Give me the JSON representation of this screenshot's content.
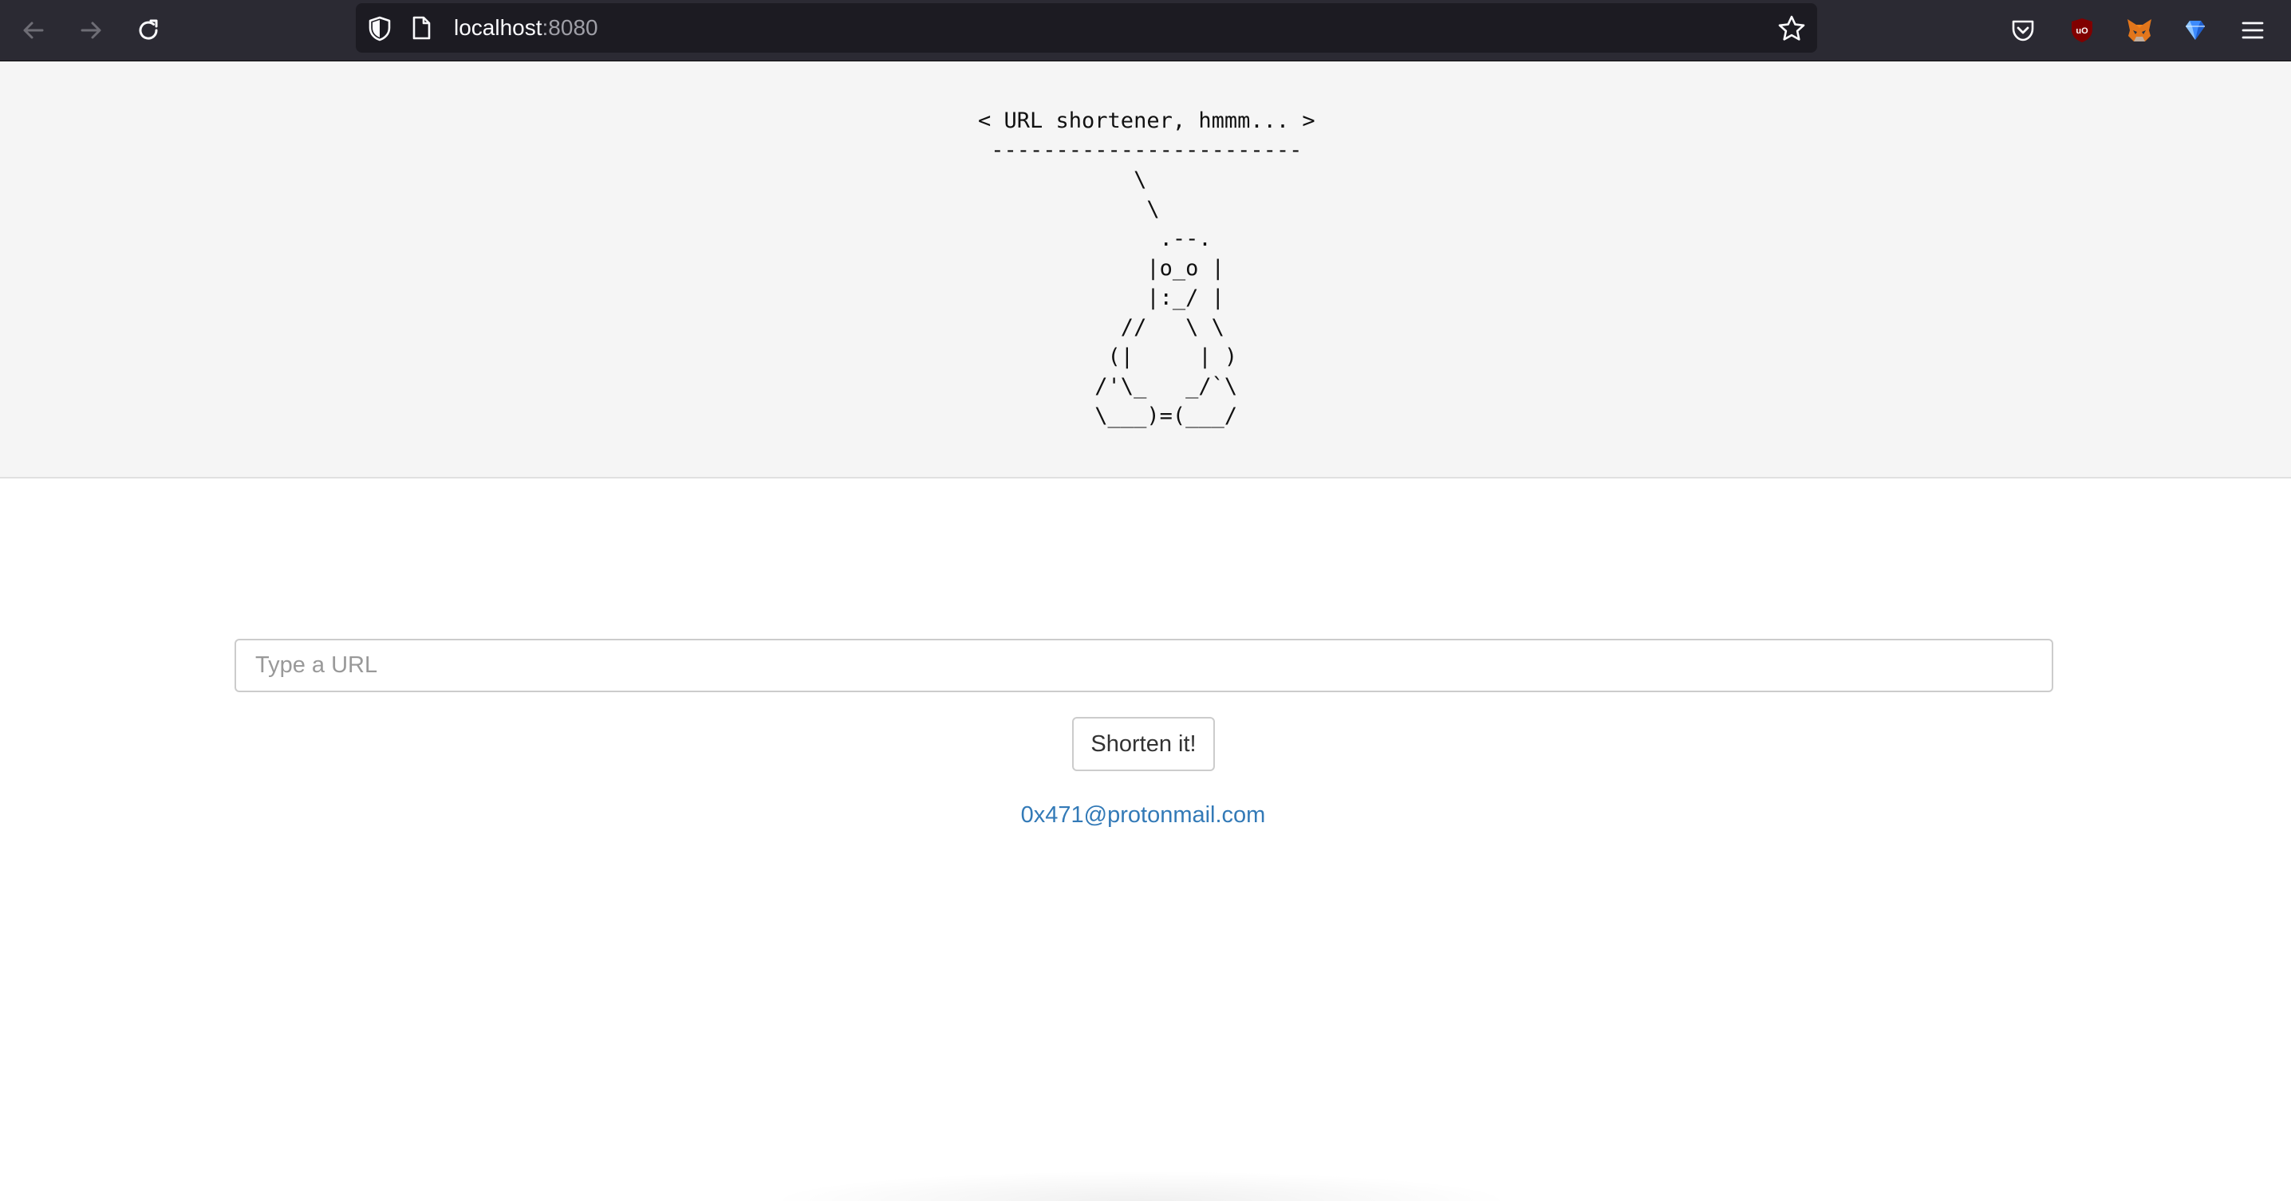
{
  "browser": {
    "url_host": "localhost",
    "url_port": ":8080",
    "nav_icons": [
      "back-arrow-icon",
      "forward-arrow-icon",
      "reload-icon"
    ],
    "toolbar_icons": [
      "pocket-icon",
      "ublock-origin-icon",
      "metamask-fox-icon",
      "gem-extension-icon",
      "hamburger-menu-icon"
    ]
  },
  "banner": {
    "ascii_art": "< URL shortener, hmmm... >\n ------------------------\n            \\\n             \\\n              .--.\n             |o_o |\n             |:_/ |\n           //   \\ \\\n          (|     | )\n         /'\\_   _/`\\\n         \\___)=(___/"
  },
  "form": {
    "input_value": "",
    "input_placeholder": "Type a URL",
    "submit_label": "Shorten it!"
  },
  "footer": {
    "contact_email": "0x471@protonmail.com"
  },
  "colors": {
    "chrome_bg": "#2b2a33",
    "urlbar_bg": "#1c1b22",
    "banner_bg": "#f5f5f5",
    "link": "#337ab7"
  }
}
